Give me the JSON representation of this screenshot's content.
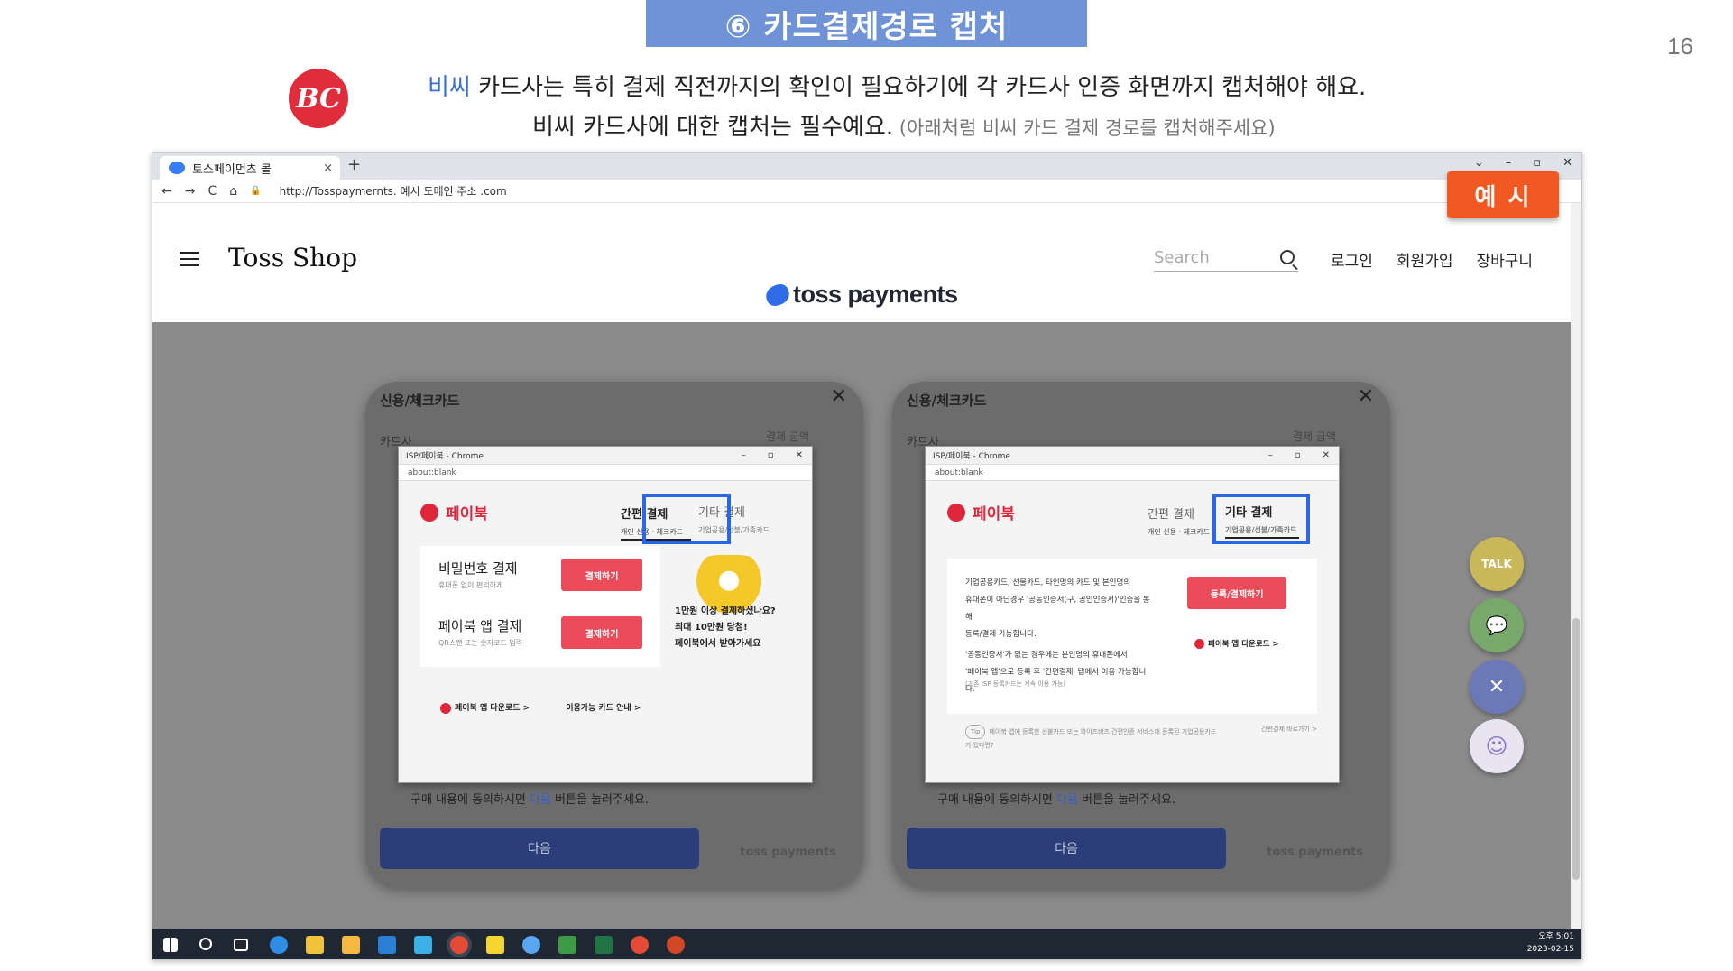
{
  "slide": {
    "title": "⑥ 카드결제경로 캡처",
    "page_number": "16",
    "logo_text": "BC",
    "line1_highlight": "비씨",
    "line1_rest": " 카드사는 특히  결제 직전까지의 확인이 필요하기에 각 카드사 인증 화면까지 캡처해야 해요.",
    "line2_main": "비씨 카드사에 대한 캡처는 필수예요.",
    "line2_sub": " (아래처럼 비씨 카드 결제 경로를 캡처해주세요)",
    "example_label": "예 시"
  },
  "browser": {
    "tab_title": "토스페이먼츠 몰",
    "tab_close": "×",
    "new_tab": "+",
    "window_controls": [
      "⌄",
      "–",
      "▫",
      "✕"
    ],
    "url": "http://Tosspaymernts. 예시 도메인 주소 .com",
    "nav_glyphs": [
      "←",
      "→",
      "C",
      "⌂",
      "🔒"
    ]
  },
  "site": {
    "title": "Toss Shop",
    "search_placeholder": "Search",
    "nav": [
      "로그인",
      "회원가입",
      "장바구니"
    ],
    "brand": "toss payments"
  },
  "modal": {
    "header": "신용/체크카드",
    "close": "✕",
    "card_label": "카드사",
    "amount_label": "결제 금액",
    "agree_prefix": "구매 내용에 동의하시면 ",
    "agree_link": "다음",
    "agree_suffix": " 버튼을 눌러주세요.",
    "next_button": "다음",
    "footer_brand": "toss payments"
  },
  "popup": {
    "window_title": "ISP/페이북 - Chrome",
    "url": "about:blank",
    "window_controls": [
      "–",
      "▫",
      "✕"
    ],
    "logo": "페이북",
    "tab_easy": "간편 결제",
    "tab_easy_sub": "개인 신용 · 체크카드",
    "tab_etc": "기타 결제",
    "tab_etc_sub": "기업공용/선불/가족카드",
    "pw_title": "비밀번호 결제",
    "pw_sub": "휴대폰 없이 편리하게",
    "app_title": "페이북 앱 결제",
    "app_sub": "QR스캔 또는 숫자코드 입력",
    "pay_button": "결제하기",
    "promo_lines": [
      "1만원 이상 결제하셨나요?",
      "최대 10만원 당첨!",
      "페이북에서 받아가세요"
    ],
    "download_link": "페이북 앱 다운로드 >",
    "cards_link": "이용가능 카드 안내 >",
    "etc_text_lines": [
      "기업공용카드, 선불카드, 타인명의 카드 및 본인명의",
      "휴대폰이 아닌경우 '공동인증서(구, 공인인증서)'인증을 통해",
      "등록/결제 가능합니다.",
      "'공동인증서'가 없는 경우에는 본인명의 휴대폰에서",
      "'페이북 앱'으로 등록 후 '간편결제' 탭에서 이용 가능합니다."
    ],
    "etc_note": "(기존 ISP 등록카드는 계속 이용 가능)",
    "etc_button": "등록/결제하기",
    "tip_badge": "Tip",
    "tip_text": "페이북 앱에 등록한 선불카드 또는 와이즈비즈 간편인증 서비스에 등록된 기업공용카드가 있다면?",
    "tip_link": "간편결제 바로가기 >"
  },
  "fabs": [
    {
      "label": "TALK",
      "color": "#c8b85a"
    },
    {
      "label": "💬",
      "color": "#79a86c"
    },
    {
      "label": "✕",
      "color": "#6b79b8"
    },
    {
      "label": "☺",
      "color": "#b8a8d8"
    }
  ],
  "taskbar": {
    "clock_time": "오후 5:01",
    "clock_date": "2023-02-15",
    "icon_colors": [
      "#ffffff",
      "#ffffff",
      "#ffffff",
      "#2f8de4",
      "#f2c33a",
      "#f5b942",
      "#2a7fd4",
      "#3ab0e6",
      "#e44b36",
      "#f5d630",
      "#5aa6f0",
      "#3d9b47",
      "#217346",
      "#e44b36",
      "#d24726"
    ]
  }
}
